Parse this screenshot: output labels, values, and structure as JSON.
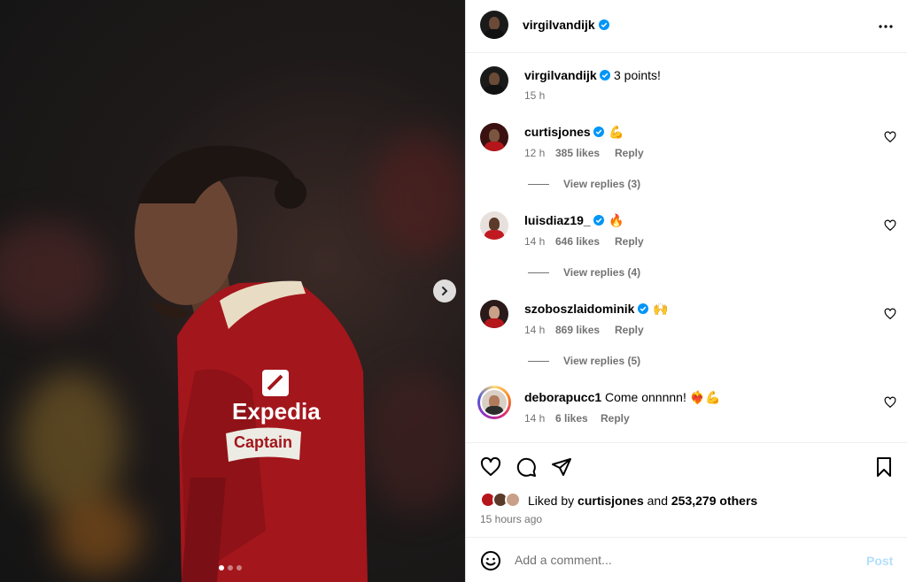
{
  "post": {
    "photo_alt": "",
    "sponsor": "Expedia",
    "armband": "Captain",
    "carousel": {
      "current": 1,
      "total": 3
    }
  },
  "header": {
    "username": "virgilvandijk"
  },
  "caption": {
    "username": "virgilvandijk",
    "text": "3 points!",
    "time": "15 h"
  },
  "comments": [
    {
      "username": "curtisjones",
      "verified": true,
      "text": "💪",
      "time": "12 h",
      "likes": "385 likes",
      "reply": "Reply",
      "view_replies": "View replies (3)"
    },
    {
      "username": "luisdiaz19_",
      "verified": true,
      "text": "🔥",
      "time": "14 h",
      "likes": "646 likes",
      "reply": "Reply",
      "view_replies": "View replies (4)"
    },
    {
      "username": "szoboszlaidominik",
      "verified": true,
      "text": "🙌",
      "time": "14 h",
      "likes": "869 likes",
      "reply": "Reply",
      "view_replies": "View replies (5)"
    },
    {
      "username": "deborapucc1",
      "verified": false,
      "text": "Come onnnnn! ❤️‍🔥💪",
      "time": "14 h",
      "likes": "6 likes",
      "reply": "Reply",
      "view_replies": ""
    }
  ],
  "likes": {
    "prefix": "Liked by",
    "user": "curtisjones",
    "and": "and",
    "others": "253,279 others"
  },
  "timestamp": "15 hours ago",
  "comment_box": {
    "placeholder": "Add a comment...",
    "post_label": "Post"
  },
  "colors": {
    "verified": "#0095f6",
    "muted": "#737373",
    "post_disabled": "#b2dffc",
    "jersey": "#a3161c"
  }
}
